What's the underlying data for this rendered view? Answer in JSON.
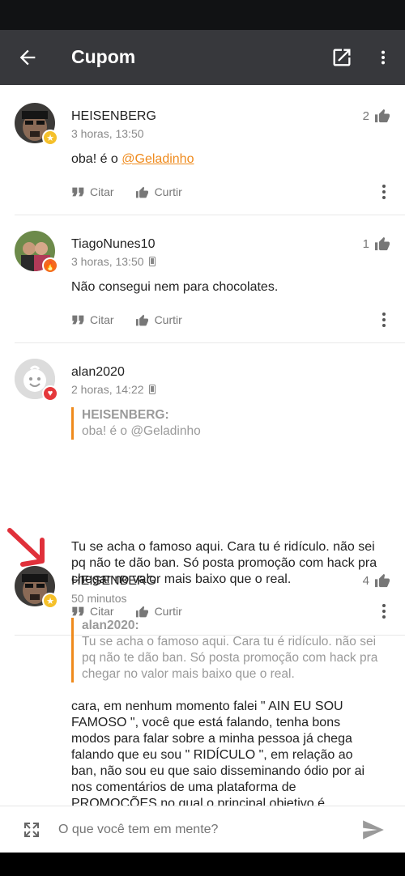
{
  "app_bar": {
    "title": "Cupom"
  },
  "comments": [
    {
      "username": "HEISENBERG",
      "time": "3 horas, 13:50",
      "likes": "2",
      "text_prefix": "oba! é o ",
      "mention": "@Geladinho",
      "badge_icon": "star-badge-icon"
    },
    {
      "username": "TiagoNunes10",
      "time": "3 horas, 13:50",
      "likes": "1",
      "text": "Não consegui nem para chocolates.",
      "badge_icon": "fire-badge-icon"
    },
    {
      "username": "alan2020",
      "time": "2 horas, 14:22",
      "quote_author": "HEISENBERG:",
      "quote_text": "oba! é o @Geladinho",
      "text": "Tu se acha o famoso aqui. Cara tu é ridículo. não sei pq não te dão ban. Só posta promoção com hack pra chegar no valor mais baixo que o real.",
      "badge_icon": "heart-badge-icon"
    },
    {
      "username": "HEISENBERG",
      "time": "50 minutos",
      "likes": "4",
      "quote_author": "alan2020:",
      "quote_text": "Tu se acha o famoso aqui. Cara tu é ridículo. não sei pq não te dão ban. Só posta promoção com hack pra chegar no valor mais baixo que o real.",
      "text": "cara, em nenhum momento falei \" AIN EU SOU FAMOSO \", você que está falando, tenha bons modos para falar sobre a minha pessoa já chega falando que eu sou \" RIDÍCULO \", em relação ao ban, não sou eu que saio disseminando ódio por ai nos comentários de uma plataforma de PROMOÇÕES no qual o principal objetivo é ECONOMIZAR, se",
      "badge_icon": "star-badge-icon"
    }
  ],
  "actions": {
    "quote_label": "Citar",
    "like_label": "Curtir"
  },
  "composer": {
    "placeholder": "O que você tem em mente?"
  },
  "colors": {
    "app_bar": "#37383c",
    "accent": "#ef8a1c",
    "arrow_annotation": "#e0303a"
  }
}
